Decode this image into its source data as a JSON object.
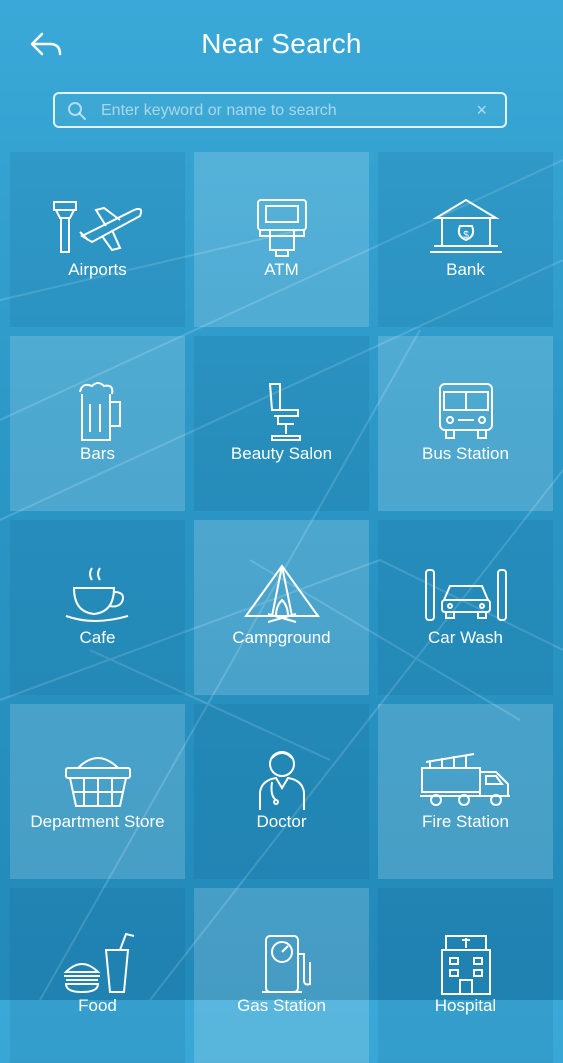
{
  "header": {
    "title": "Near Search",
    "back_icon": "back-arrow-icon"
  },
  "search": {
    "placeholder": "Enter keyword or name to search",
    "value": "",
    "clear_label": "×"
  },
  "categories": [
    {
      "label": "Airports",
      "icon": "airport-icon"
    },
    {
      "label": "ATM",
      "icon": "atm-icon"
    },
    {
      "label": "Bank",
      "icon": "bank-icon"
    },
    {
      "label": "Bars",
      "icon": "beer-mug-icon"
    },
    {
      "label": "Beauty Salon",
      "icon": "salon-chair-icon"
    },
    {
      "label": "Bus Station",
      "icon": "bus-icon"
    },
    {
      "label": "Cafe",
      "icon": "coffee-cup-icon"
    },
    {
      "label": "Campground",
      "icon": "tent-icon"
    },
    {
      "label": "Car Wash",
      "icon": "car-wash-icon"
    },
    {
      "label": "Department Store",
      "icon": "shopping-basket-icon"
    },
    {
      "label": "Doctor",
      "icon": "doctor-icon"
    },
    {
      "label": "Fire Station",
      "icon": "fire-truck-icon"
    },
    {
      "label": "Food",
      "icon": "burger-drink-icon"
    },
    {
      "label": "Gas Station",
      "icon": "gas-pump-icon"
    },
    {
      "label": "Hospital",
      "icon": "hospital-icon"
    }
  ],
  "colors": {
    "background": "#2b97c6",
    "text": "#ffffff"
  }
}
